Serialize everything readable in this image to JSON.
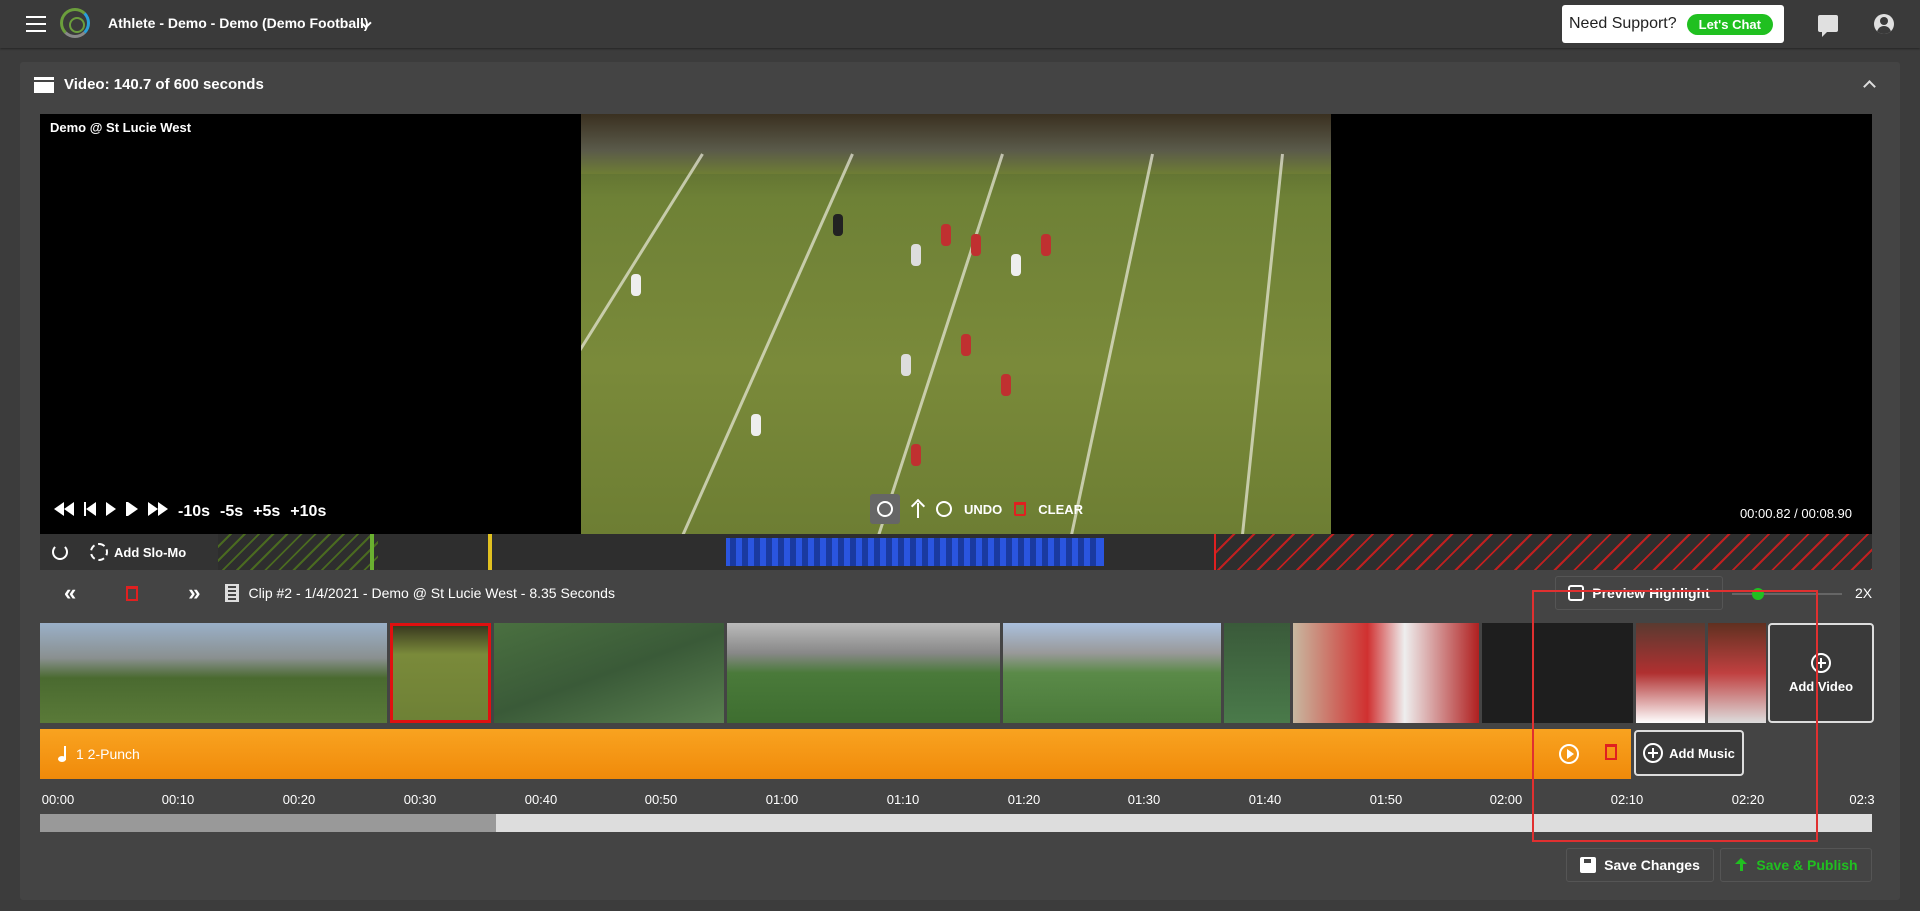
{
  "app": {
    "title": "Athlete - Demo - Demo (Demo Football)",
    "support_text": "Need Support?",
    "chat_label": "Let's Chat"
  },
  "panel": {
    "header": "Video: 140.7 of 600 seconds"
  },
  "player": {
    "game_title": "Demo @ St Lucie West",
    "skip_buttons": [
      "-10s",
      "-5s",
      "+5s",
      "+10s"
    ],
    "undo_label": "UNDO",
    "clear_label": "CLEAR",
    "time_readout": "00:00.82 / 00:08.90"
  },
  "timeline": {
    "slomo_label": "Add Slo-Mo"
  },
  "clip_nav": {
    "clip_info": "Clip #2 - 1/4/2021 - Demo @ St Lucie West - 8.35 Seconds",
    "preview_label": "Preview Highlight",
    "speed_label": "2X"
  },
  "clips": {
    "add_video_label": "Add Video"
  },
  "music": {
    "track_label": "1 2-Punch",
    "add_music_label": "Add Music"
  },
  "ruler": {
    "ticks": [
      "00:00",
      "00:10",
      "00:20",
      "00:30",
      "00:40",
      "00:50",
      "01:00",
      "01:10",
      "01:20",
      "01:30",
      "01:40",
      "01:50",
      "02:00",
      "02:10",
      "02:20",
      "02:3"
    ]
  },
  "footer": {
    "save_label": "Save Changes",
    "publish_label": "Save & Publish"
  },
  "colors": {
    "accent_green": "#20c020",
    "music_orange": "#f5960f",
    "selection_red": "#e01010",
    "range_blue": "#2a55e0"
  }
}
